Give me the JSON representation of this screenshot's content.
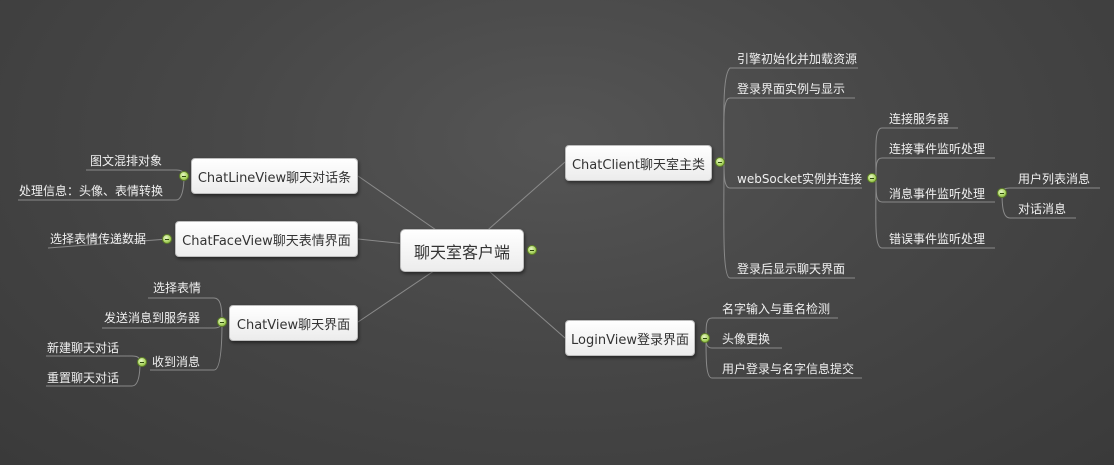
{
  "central": "聊天室客户端",
  "right": {
    "chatclient": {
      "label": "ChatClient聊天室主类",
      "items": [
        "引擎初始化并加载资源",
        "登录界面实例与显示",
        "webSocket实例并连接",
        "登录后显示聊天界面"
      ],
      "websocket_children": [
        "连接服务器",
        "连接事件监听处理",
        "消息事件监听处理",
        "错误事件监听处理"
      ],
      "message_children": [
        "用户列表消息",
        "对话消息"
      ]
    },
    "loginview": {
      "label": "LoginView登录界面",
      "items": [
        "名字输入与重名检测",
        "头像更换",
        "用户登录与名字信息提交"
      ]
    }
  },
  "left": {
    "chatlineview": {
      "label": "ChatLineView聊天对话条",
      "items": [
        "图文混排对象",
        "处理信息：头像、表情转换"
      ]
    },
    "chatfaceview": {
      "label": "ChatFaceView聊天表情界面",
      "items": [
        "选择表情传递数据"
      ]
    },
    "chatview": {
      "label": "ChatView聊天界面",
      "items": [
        "选择表情",
        "发送消息到服务器",
        "收到消息"
      ],
      "received_children": [
        "新建聊天对话",
        "重置聊天对话"
      ]
    }
  }
}
